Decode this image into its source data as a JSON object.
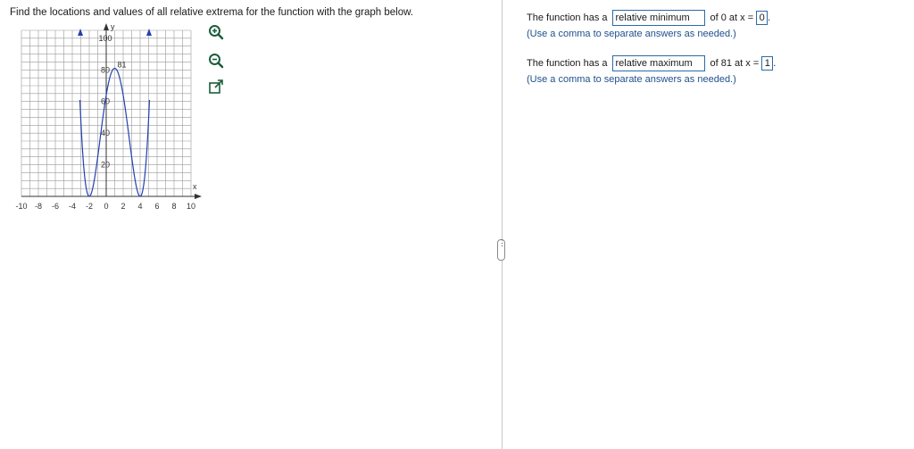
{
  "question": "Find the locations and values of all relative extrema for the function with the graph below.",
  "graph": {
    "y_axis_label": "y",
    "x_axis_label": "x",
    "x_ticks": [
      "-10",
      "-8",
      "-6",
      "-4",
      "-2",
      "0",
      "2",
      "4",
      "6",
      "8",
      "10"
    ],
    "y_ticks": [
      "100",
      "80",
      "60",
      "40",
      "20"
    ],
    "peak_label": "81",
    "curve_color": "#2340b0"
  },
  "tools": {
    "zoom_in_icon": "magnifier-plus-icon",
    "zoom_out_icon": "magnifier-minus-icon",
    "popout_icon": "external-link-icon"
  },
  "answers": {
    "line1": {
      "prefix": "The function has a",
      "dropdown": "relative minimum",
      "middle": "of 0 at x =",
      "value": "0",
      "suffix": "."
    },
    "hint1": "(Use a comma to separate answers as needed.)",
    "line2": {
      "prefix": "The function has a",
      "dropdown": "relative maximum",
      "middle": "of 81 at x =",
      "value": "1",
      "suffix": "."
    },
    "hint2": "(Use a comma to separate answers as needed.)"
  },
  "handle_glyph": "⋮",
  "colors": {
    "accent": "#2c6aa8",
    "hint": "#1f4f8c",
    "curve": "#2340b0"
  }
}
